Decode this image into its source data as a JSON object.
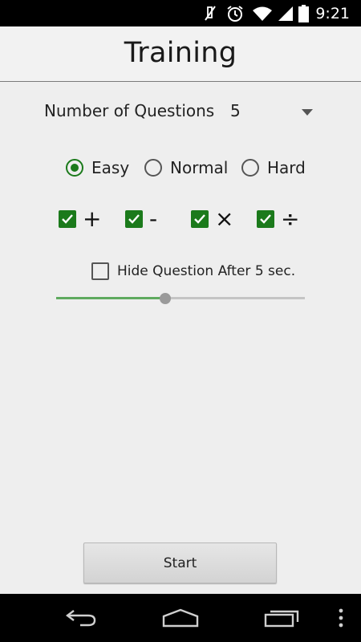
{
  "status_bar": {
    "time": "9:21",
    "icons": [
      "mute-icon",
      "alarm-icon",
      "wifi-icon",
      "signal-icon",
      "battery-icon"
    ]
  },
  "header": {
    "title": "Training"
  },
  "questions": {
    "label": "Number of Questions",
    "value": "5"
  },
  "difficulty": {
    "options": [
      "Easy",
      "Normal",
      "Hard"
    ],
    "selected": "Easy"
  },
  "operators": [
    {
      "symbol": "+",
      "checked": true
    },
    {
      "symbol": "-",
      "checked": true
    },
    {
      "symbol": "×",
      "checked": true
    },
    {
      "symbol": "÷",
      "checked": true
    }
  ],
  "hide_question": {
    "label": "Hide Question After 5 sec.",
    "checked": false
  },
  "slider": {
    "value_fraction": 0.44
  },
  "start_button": {
    "label": "Start"
  },
  "nav_bar": {
    "icons": [
      "back-icon",
      "home-icon",
      "recents-icon",
      "menu-icon"
    ]
  },
  "colors": {
    "accent": "#1b7a1b",
    "slider_fill": "#5faa5f",
    "background": "#eeeeee"
  }
}
